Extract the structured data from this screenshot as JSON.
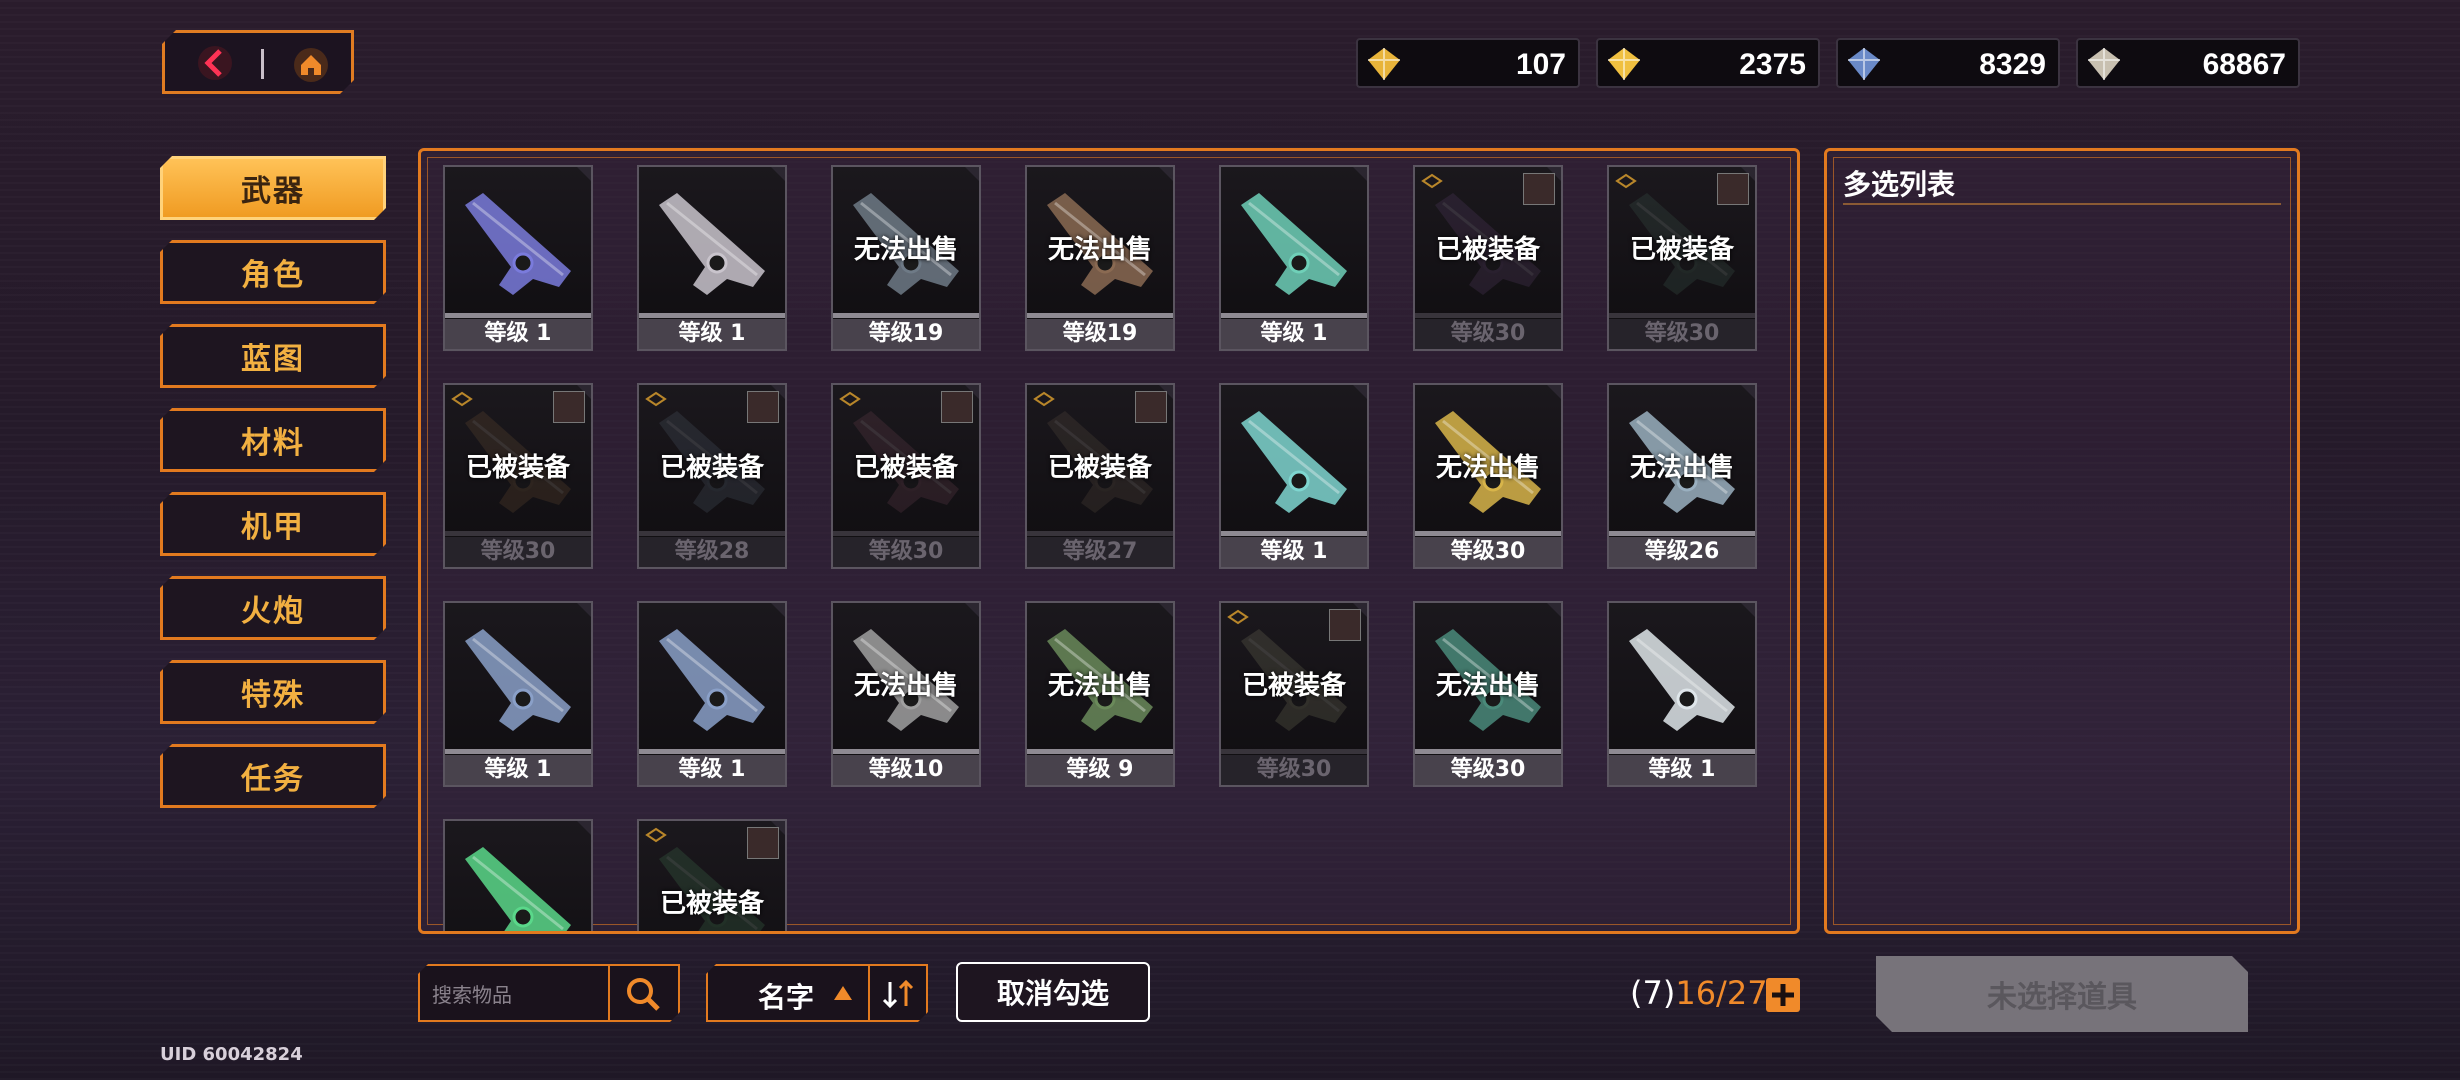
{
  "nav": {
    "back_icon": "chevron-left-icon",
    "home_icon": "home-icon"
  },
  "currencies": [
    {
      "icon": "gem-premium-icon",
      "value": "107"
    },
    {
      "icon": "gem-icon",
      "value": "2375"
    },
    {
      "icon": "chip-icon",
      "value": "8329"
    },
    {
      "icon": "ticket-icon",
      "value": "68867"
    }
  ],
  "categories": [
    {
      "label": "武器",
      "active": true
    },
    {
      "label": "角色",
      "active": false
    },
    {
      "label": "蓝图",
      "active": false
    },
    {
      "label": "材料",
      "active": false
    },
    {
      "label": "机甲",
      "active": false
    },
    {
      "label": "火炮",
      "active": false
    },
    {
      "label": "特殊",
      "active": false
    },
    {
      "label": "任务",
      "active": false
    }
  ],
  "items": [
    {
      "level": "等级 1",
      "status": "",
      "dim": false,
      "color": "#7a7bdc"
    },
    {
      "level": "等级 1",
      "status": "",
      "dim": false,
      "color": "#c9c4cc"
    },
    {
      "level": "等级19",
      "status": "无法出售",
      "dim": false,
      "color": "#6e7a86"
    },
    {
      "level": "等级19",
      "status": "无法出售",
      "dim": false,
      "color": "#8a6a52"
    },
    {
      "level": "等级 1",
      "status": "",
      "dim": false,
      "color": "#6fd0b8"
    },
    {
      "level": "等级30",
      "status": "已被装备",
      "dim": true,
      "color": "#6a4a7a"
    },
    {
      "level": "等级30",
      "status": "已被装备",
      "dim": true,
      "color": "#4a6a5a"
    },
    {
      "level": "等级30",
      "status": "已被装备",
      "dim": true,
      "color": "#7a5a3a"
    },
    {
      "level": "等级28",
      "status": "已被装备",
      "dim": true,
      "color": "#5a6a7a"
    },
    {
      "level": "等级30",
      "status": "已被装备",
      "dim": true,
      "color": "#7a4a5a"
    },
    {
      "level": "等级27",
      "status": "已被装备",
      "dim": true,
      "color": "#6a5a4a"
    },
    {
      "level": "等级 1",
      "status": "",
      "dim": false,
      "color": "#7fd6d0"
    },
    {
      "level": "等级30",
      "status": "无法出售",
      "dim": false,
      "color": "#d8b54a"
    },
    {
      "level": "等级26",
      "status": "无法出售",
      "dim": false,
      "color": "#9ab0c0"
    },
    {
      "level": "等级 1",
      "status": "",
      "dim": false,
      "color": "#8aa0c8"
    },
    {
      "level": "等级 1",
      "status": "",
      "dim": false,
      "color": "#8aa0c8"
    },
    {
      "level": "等级10",
      "status": "无法出售",
      "dim": false,
      "color": "#a0a0a0"
    },
    {
      "level": "等级 9",
      "status": "无法出售",
      "dim": false,
      "color": "#6a8a5a"
    },
    {
      "level": "等级30",
      "status": "已被装备",
      "dim": true,
      "color": "#8a8a6a"
    },
    {
      "level": "等级30",
      "status": "无法出售",
      "dim": false,
      "color": "#4a8a7a"
    },
    {
      "level": "等级 1",
      "status": "",
      "dim": false,
      "color": "#dfe6ea"
    },
    {
      "level": "",
      "status": "",
      "dim": false,
      "color": "#5ad88a"
    },
    {
      "level": "",
      "status": "已被装备",
      "dim": true,
      "color": "#4a8a5a"
    }
  ],
  "side_panel": {
    "title": "多选列表"
  },
  "search": {
    "placeholder": "搜索物品",
    "icon": "search-icon"
  },
  "sort": {
    "label": "名字",
    "order_icon": "sort-order-icon"
  },
  "deselect_label": "取消勾选",
  "count": {
    "prefix": "(7)",
    "selected": "16",
    "suffix": "/27"
  },
  "add_icon": "plus-icon",
  "confirm_label": "未选择道具",
  "uid": "UID 60042824",
  "colors": {
    "accent": "#e27a1f",
    "active": "#f5a52c"
  }
}
